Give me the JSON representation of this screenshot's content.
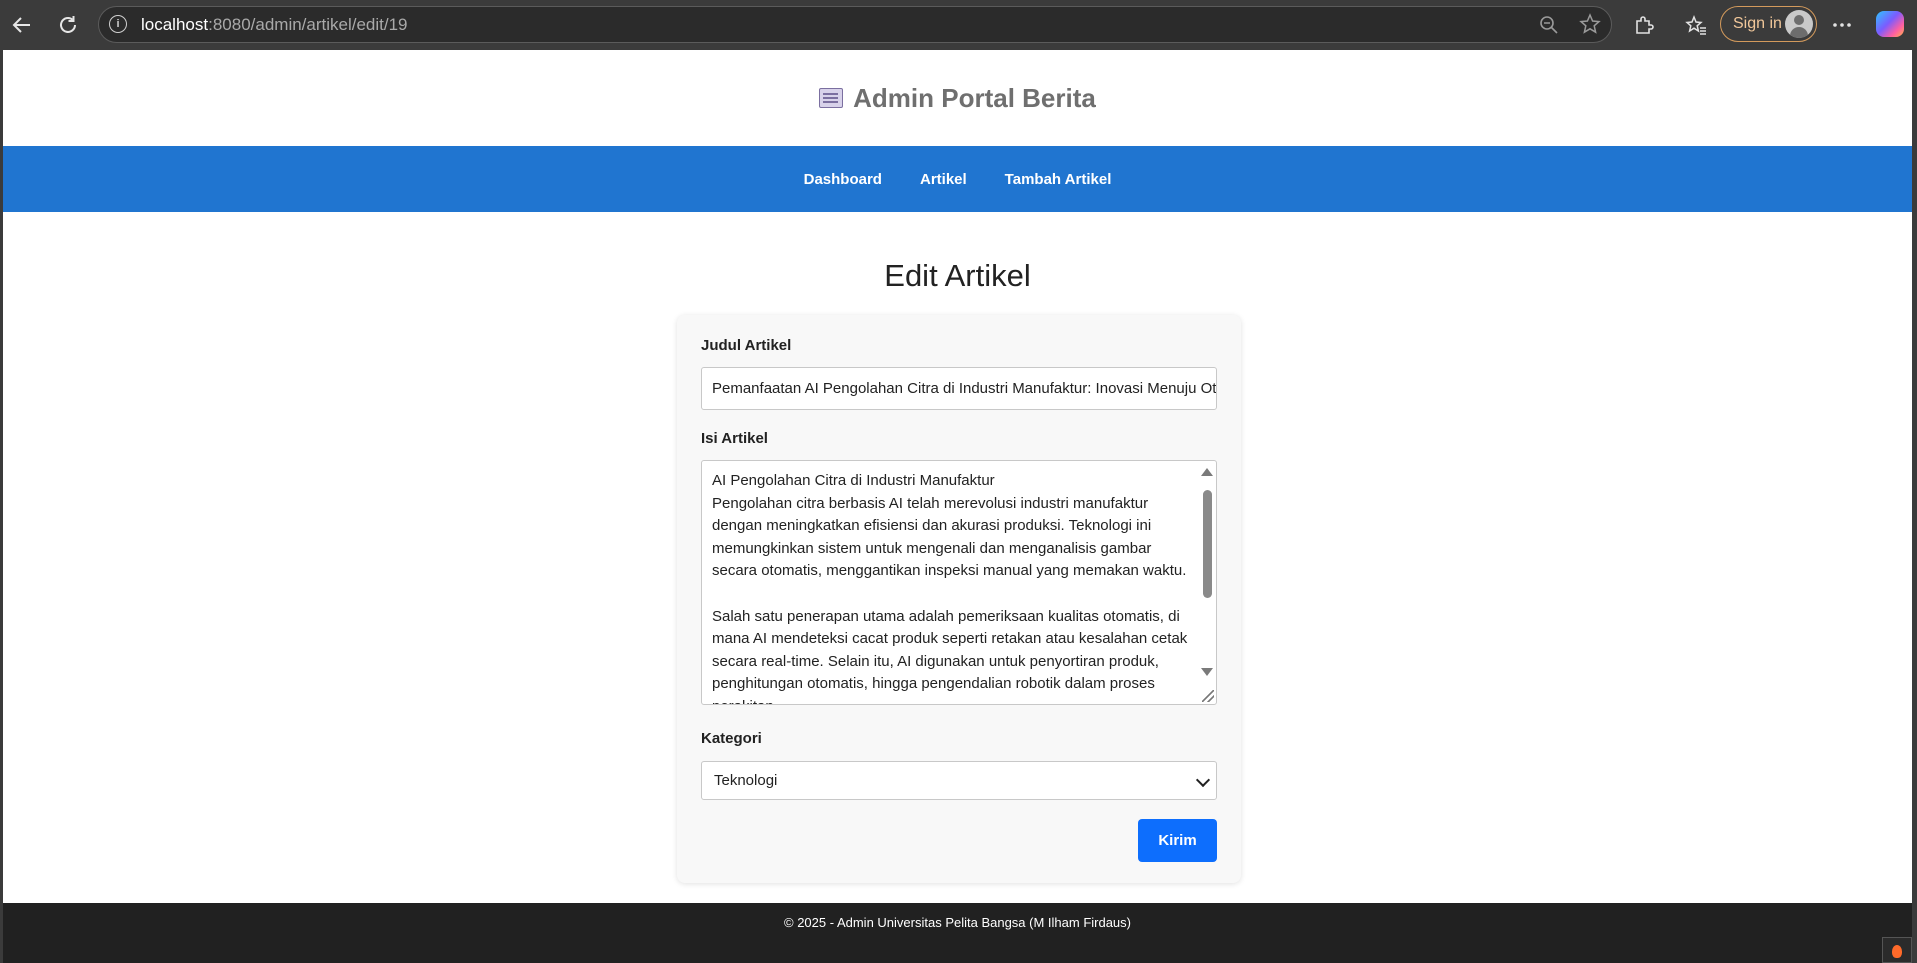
{
  "browser": {
    "url_host": "localhost",
    "url_rest": ":8080/admin/artikel/edit/19",
    "signin_label": "Sign in",
    "icons": [
      "back-icon",
      "reload-icon",
      "info-icon",
      "zoom-out-icon",
      "star-icon",
      "extensions-icon",
      "favorites-icon",
      "more-icon",
      "copilot-icon"
    ]
  },
  "site": {
    "title": "Admin Portal Berita",
    "title_icon": "newspaper-icon"
  },
  "nav": {
    "items": [
      "Dashboard",
      "Artikel",
      "Tambah Artikel"
    ]
  },
  "page": {
    "title": "Edit Artikel"
  },
  "form": {
    "judul_label": "Judul Artikel",
    "judul_value": "Pemanfaatan AI Pengolahan Citra di Industri Manufaktur: Inovasi Menuju Otomatisasi Cerdas",
    "isi_label": "Isi Artikel",
    "isi_value": "AI Pengolahan Citra di Industri Manufaktur\nPengolahan citra berbasis AI telah merevolusi industri manufaktur dengan meningkatkan efisiensi dan akurasi produksi. Teknologi ini memungkinkan sistem untuk mengenali dan menganalisis gambar secara otomatis, menggantikan inspeksi manual yang memakan waktu.\n\nSalah satu penerapan utama adalah pemeriksaan kualitas otomatis, di mana AI mendeteksi cacat produk seperti retakan atau kesalahan cetak secara real-time. Selain itu, AI digunakan untuk penyortiran produk, penghitungan otomatis, hingga pengendalian robotik dalam proses perakitan.",
    "kategori_label": "Kategori",
    "kategori_value": "Teknologi",
    "submit_label": "Kirim"
  },
  "footer": {
    "text": "© 2025 - Admin Universitas Pelita Bangsa (M Ilham Firdaus)"
  },
  "colors": {
    "navbar": "#2075d0",
    "button": "#0d6efd",
    "footer": "#212121"
  }
}
